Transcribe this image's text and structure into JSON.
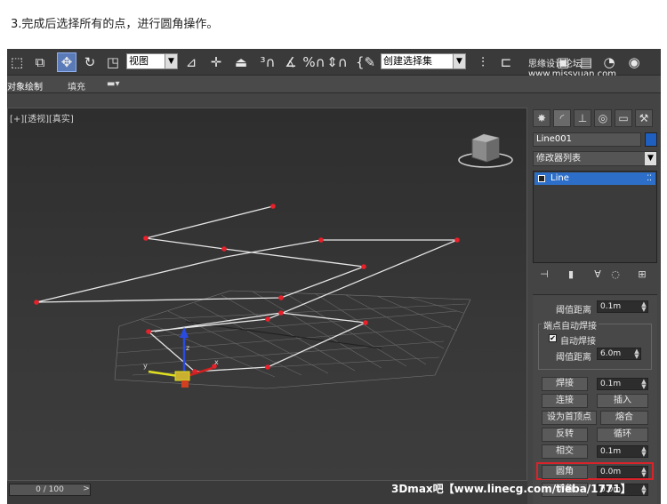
{
  "caption": "3.完成后选择所有的点，进行圆角操作。",
  "toolbar": {
    "view_select": "视图",
    "selection_set": "创建选择集",
    "logo_text": "思缘设计论坛 www.missyuan.com"
  },
  "ribbon": {
    "tab1": "对象绘制",
    "tab2": "填充"
  },
  "viewport": {
    "label": "[+][透视][真实]"
  },
  "panel": {
    "object_name": "Line001",
    "modifier_list": "修改器列表",
    "stack_item": "Line",
    "threshold_top_label": "阈值距离",
    "threshold_top_value": "0.1m",
    "endpoint_weld_group": "端点自动焊接",
    "auto_weld_label": "自动焊接",
    "threshold_label": "阈值距离",
    "threshold_value": "6.0m",
    "weld_button": "焊接",
    "weld_value": "0.1m",
    "connect_button": "连接",
    "insert_button": "插入",
    "set_first_vertex_button": "设为首顶点",
    "fuse_button": "熔合",
    "reverse_button": "反转",
    "cycle_button": "循环",
    "cross_button": "相交",
    "cross_value": "0.1m",
    "fillet_button": "圆角",
    "fillet_value": "0.0m",
    "chamfer_button": "切角",
    "chamfer_value": "0.0m",
    "auto_weld_checked": true
  },
  "status": {
    "time": "0 / 100",
    "next": ">"
  },
  "watermark": "3Dmax吧【www.linecg.com/tieba/1771】",
  "colors": {
    "vertex": "#e8202a",
    "spline": "#e6e6e6",
    "selection_highlight": "#d9232a",
    "object_color": "#1f5fbf"
  }
}
